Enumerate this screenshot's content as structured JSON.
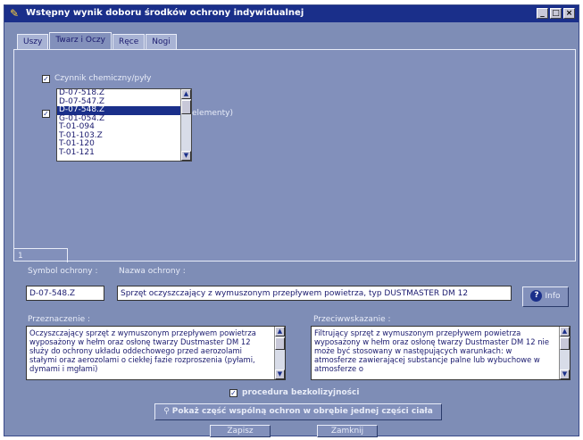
{
  "window": {
    "title": "Wstępny wynik doboru środków ochrony indywidualnej"
  },
  "tabs": [
    "Uszy",
    "Twarz i Oczy",
    "Ręce",
    "Nogi"
  ],
  "panel": {
    "factor1_label": "Czynnik chemiczny/pyły",
    "factor2_label_partial": "elementy)",
    "list_items": [
      "D-07-518.Z",
      "D-07-547.Z",
      "D-07-548.Z",
      "G-01-054.Z",
      "T-01-094",
      "T-01-103.Z",
      "T-01-120",
      "T-01-121"
    ],
    "selected_item": "D-07-548.Z",
    "page_tab": "1"
  },
  "details": {
    "symbol_label": "Symbol ochrony :",
    "symbol_value": "D-07-548.Z",
    "name_label": "Nazwa ochrony :",
    "name_value": "Sprzęt oczyszczający z wymuszonym przepływem powietrza, typ DUSTMASTER DM 12",
    "info_label": "Info",
    "purpose_label": "Przeznaczenie :",
    "purpose_text": "Oczyszczający sprzęt z wymuszonym przepływem powietrza wyposażony w hełm oraz osłonę twarzy Dustmaster DM 12 służy do ochrony układu oddechowego przed aerozolami stałymi oraz aerozolami o ciekłej fazie rozproszenia (pyłami, dymami i mgłami)",
    "contra_label": "Przeciwwskazanie :",
    "contra_text": "Filtrujący sprzęt z wymuszonym przepływem powietrza wyposażony w hełm oraz osłonę twarzy Dustmaster DM 12 nie może być stosowany w następujących warunkach: w atmosferze zawierającej substancje palne lub wybuchowe w atmosferze o"
  },
  "footer": {
    "procedure_label": "procedura bezkolizyjności",
    "show_common_label": "Pokaż część wspólną ochron w obrębie jednej części ciała",
    "save_label": "Zapisz",
    "close_label": "Zamknij"
  },
  "colors": {
    "title_bar": "#1a2f8a",
    "window_bg": "#7e8db6",
    "panel_bg": "#8290bb",
    "selection": "#1a2f8a"
  }
}
